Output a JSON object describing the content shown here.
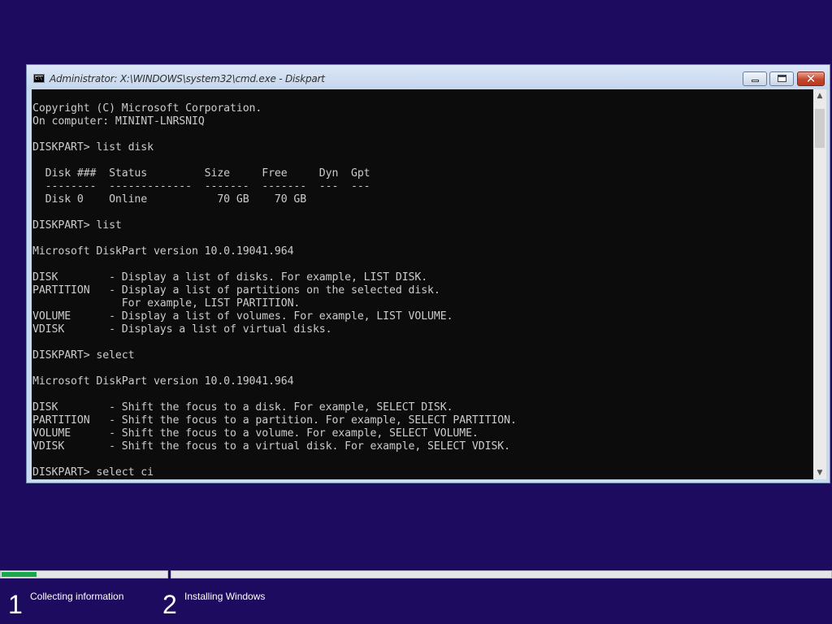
{
  "window": {
    "title": "Administrator: X:\\WINDOWS\\system32\\cmd.exe - Diskpart",
    "controls": {
      "minimize": "minimize",
      "maximize": "maximize",
      "close": "✕"
    }
  },
  "console": {
    "lines": [
      "Copyright (C) Microsoft Corporation.",
      "On computer: MININT-LNRSNIQ",
      "",
      "DISKPART> list disk",
      "",
      "  Disk ###  Status         Size     Free     Dyn  Gpt",
      "  --------  -------------  -------  -------  ---  ---",
      "  Disk 0    Online           70 GB    70 GB",
      "",
      "DISKPART> list",
      "",
      "Microsoft DiskPart version 10.0.19041.964",
      "",
      "DISK        - Display a list of disks. For example, LIST DISK.",
      "PARTITION   - Display a list of partitions on the selected disk.",
      "              For example, LIST PARTITION.",
      "VOLUME      - Display a list of volumes. For example, LIST VOLUME.",
      "VDISK       - Displays a list of virtual disks.",
      "",
      "DISKPART> select",
      "",
      "Microsoft DiskPart version 10.0.19041.964",
      "",
      "DISK        - Shift the focus to a disk. For example, SELECT DISK.",
      "PARTITION   - Shift the focus to a partition. For example, SELECT PARTITION.",
      "VOLUME      - Shift the focus to a volume. For example, SELECT VOLUME.",
      "VDISK       - Shift the focus to a virtual disk. For example, SELECT VDISK.",
      "",
      "DISKPART> select ci"
    ]
  },
  "scrollbar": {
    "up_icon": "▲",
    "down_icon": "▼"
  },
  "setup": {
    "progress": {
      "step_1_fraction": 0.21
    },
    "steps": [
      {
        "number": "1",
        "label": "Collecting information"
      },
      {
        "number": "2",
        "label": "Installing Windows"
      }
    ]
  },
  "colors": {
    "background": "#1c0b5e",
    "console_bg": "#0c0c0c",
    "console_text": "#cccccc",
    "progress_fill": "#19a84a"
  }
}
